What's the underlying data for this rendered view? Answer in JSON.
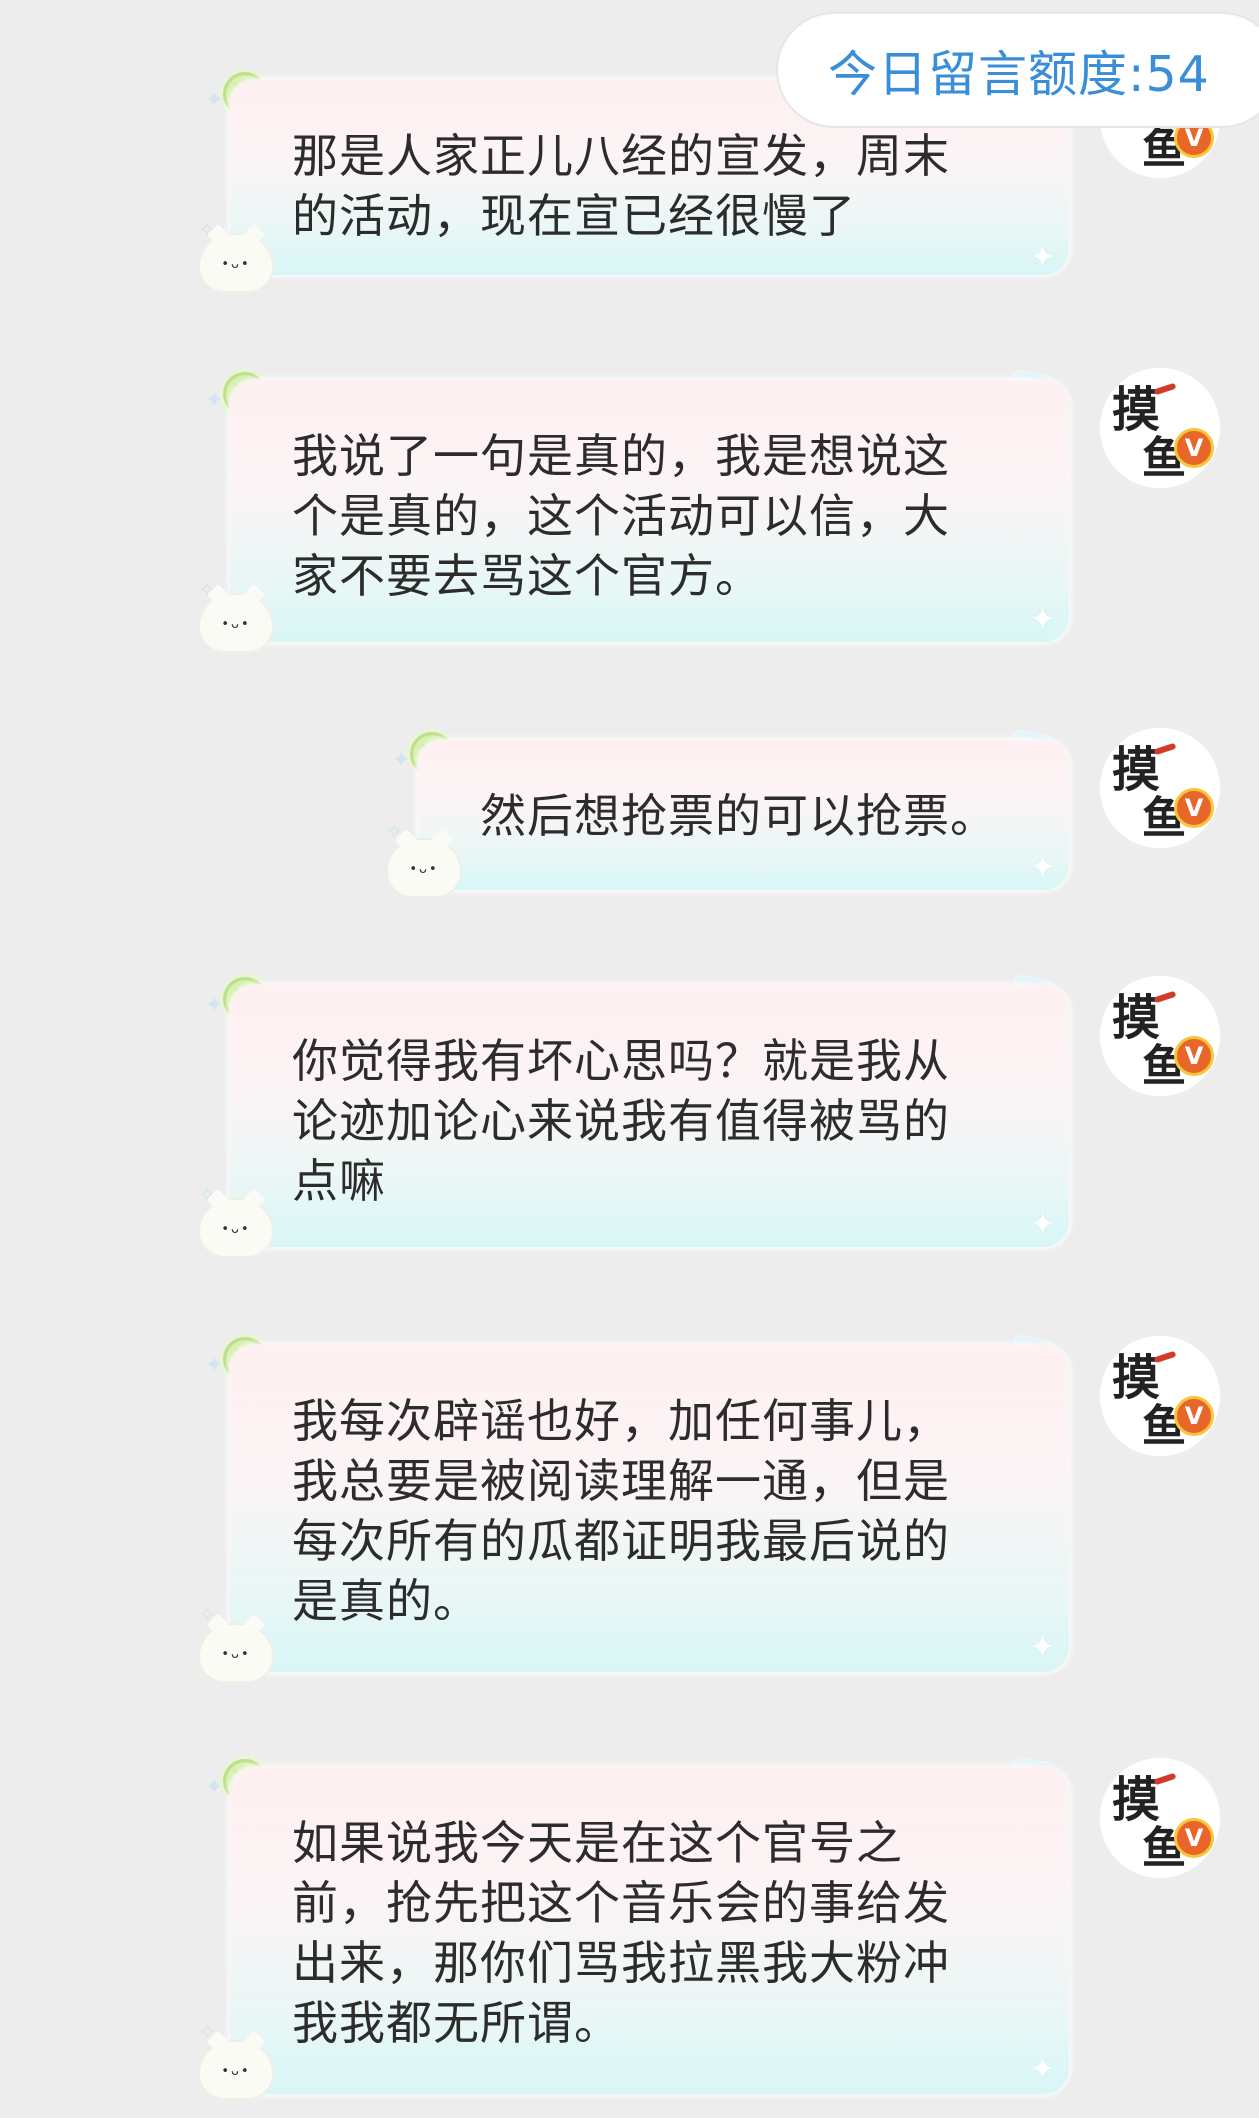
{
  "header": {
    "quota_label": "今日留言额度:54"
  },
  "messages": [
    {
      "text": "那是人家正儿八经的宣发，周末\n的活动，现在宣已经很慢了"
    },
    {
      "text": "我说了一句是真的，我是想说这\n个是真的，这个活动可以信，大\n家不要去骂这个官方。"
    },
    {
      "text": "然后想抢票的可以抢票。"
    },
    {
      "text": "你觉得我有坏心思吗？就是我从\n论迹加论心来说我有值得被骂的\n点嘛"
    },
    {
      "text": "我每次辟谣也好，加任何事儿，\n我总要是被阅读理解一通，但是\n每次所有的瓜都证明我最后说的\n是真的。"
    },
    {
      "text": "如果说我今天是在这个官号之\n前，抢先把这个音乐会的事给发\n出来，那你们骂我拉黑我大粉冲\n我我都无所谓。"
    }
  ],
  "avatar": {
    "glyph_top": "摸",
    "glyph_bottom": "鱼",
    "badge": "V",
    "badge_color": "#e8662a"
  },
  "theme": {
    "background": "#ededed",
    "quota_color": "#3a8ed8"
  }
}
